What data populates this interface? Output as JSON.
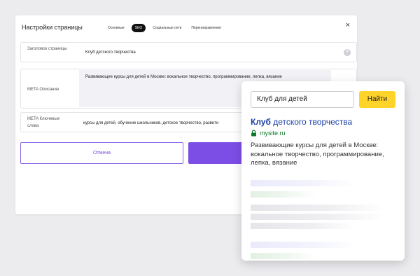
{
  "settings": {
    "title": "Настройки страницы",
    "tabs": [
      {
        "label": "Основные"
      },
      {
        "label": "SEO"
      },
      {
        "label": "Социальные сети"
      },
      {
        "label": "Перенаправления"
      }
    ],
    "active_tab": "SEO",
    "close_label": "×",
    "fields": [
      {
        "label": "Заголовок страницы",
        "value": "Клуб детского творчества"
      },
      {
        "label": "META Описание",
        "value": "Развивающие курсы для детей в Москве: вокальное творчество, программирование, лепка, вязание"
      },
      {
        "label": "META Ключевые слова",
        "value": "курсы для детей, обучение школьников, детское творчество, развити"
      }
    ],
    "info_icon_label": "?",
    "cancel_label": "Отмена"
  },
  "search_preview": {
    "query": "Клуб для детей",
    "button_label": "Найти",
    "result": {
      "title_bold": "Клуб",
      "title_rest": " детского творчества",
      "url": "mysite.ru",
      "snippet": "Развивающие курсы для детей в Москве: вокальное творчество, программирование, лепка, вязание"
    }
  },
  "colors": {
    "accent": "#7c4ee6",
    "search_button": "#fed42b",
    "link": "#1a3ea8",
    "url": "#0d7a2a"
  }
}
